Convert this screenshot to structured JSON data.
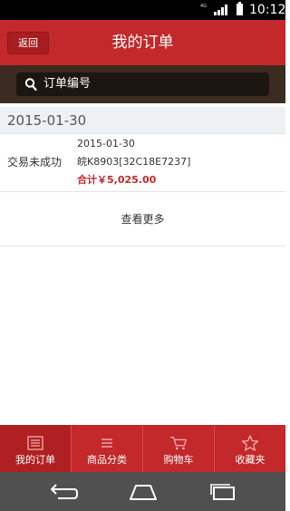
{
  "status_bar": {
    "network": "4G",
    "time": "10:12"
  },
  "header": {
    "back_label": "返回",
    "title": "我的订单"
  },
  "search": {
    "placeholder": "订单编号"
  },
  "orders": {
    "group_date": "2015-01-30",
    "item": {
      "status": "交易未成功",
      "date": "2015-01-30",
      "id": "皖K8903[32C18E7237]",
      "total": "合计￥5,025.00"
    },
    "view_more": "查看更多"
  },
  "tabs": [
    {
      "label": "我的订单",
      "icon": "list-icon",
      "active": true
    },
    {
      "label": "商品分类",
      "icon": "menu-icon",
      "active": false
    },
    {
      "label": "购物车",
      "icon": "cart-icon",
      "active": false
    },
    {
      "label": "收藏夹",
      "icon": "star-icon",
      "active": false
    }
  ],
  "colors": {
    "primary": "#c3282a",
    "search_bg": "#3c2b20",
    "total_text": "#c3282a"
  }
}
